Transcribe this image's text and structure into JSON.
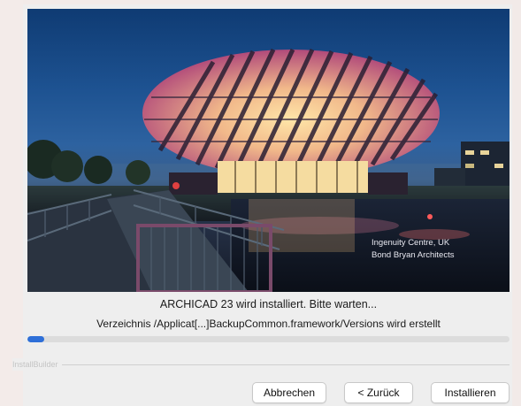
{
  "hero": {
    "caption_line1": "Ingenuity Centre, UK",
    "caption_line2": "Bond Bryan Architects"
  },
  "status": {
    "main": "ARCHICAD 23 wird installiert. Bitte warten...",
    "detail": "Verzeichnis /Applicat[...]BackupCommon.framework/Versions wird erstellt"
  },
  "progress": {
    "fraction": 0.035,
    "color": "#2e6fd8"
  },
  "brand": {
    "label": "InstallBuilder"
  },
  "buttons": {
    "cancel": "Abbrechen",
    "back": "< Zurück",
    "install": "Installieren"
  }
}
